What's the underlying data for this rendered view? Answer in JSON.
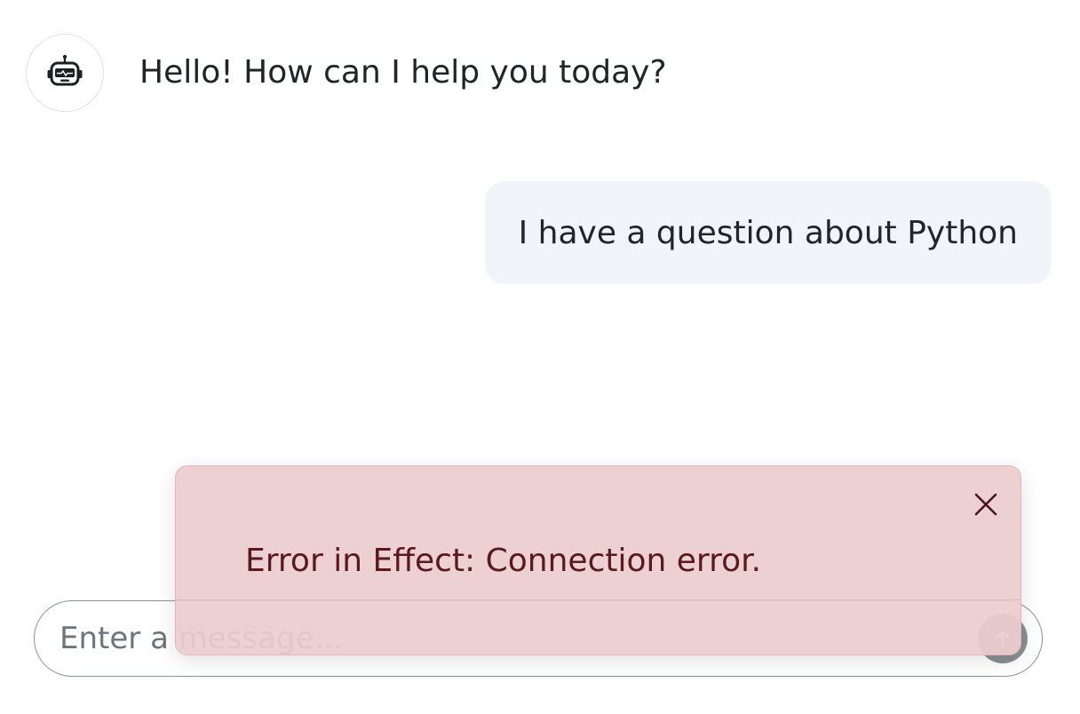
{
  "conversation": {
    "assistant_message": "Hello! How can I help you today?",
    "user_message": "I have a question about Python"
  },
  "composer": {
    "placeholder": "Enter a message...",
    "value": ""
  },
  "toast": {
    "message": "Error in Effect: Connection error."
  },
  "icons": {
    "avatar": "robot-icon",
    "send": "arrow-up-icon",
    "close": "close-icon"
  },
  "colors": {
    "user_bubble": "#f1f5fa",
    "toast_background": "#eccccf",
    "toast_text": "#5a1a1d",
    "send_button": "#8b8f94"
  }
}
